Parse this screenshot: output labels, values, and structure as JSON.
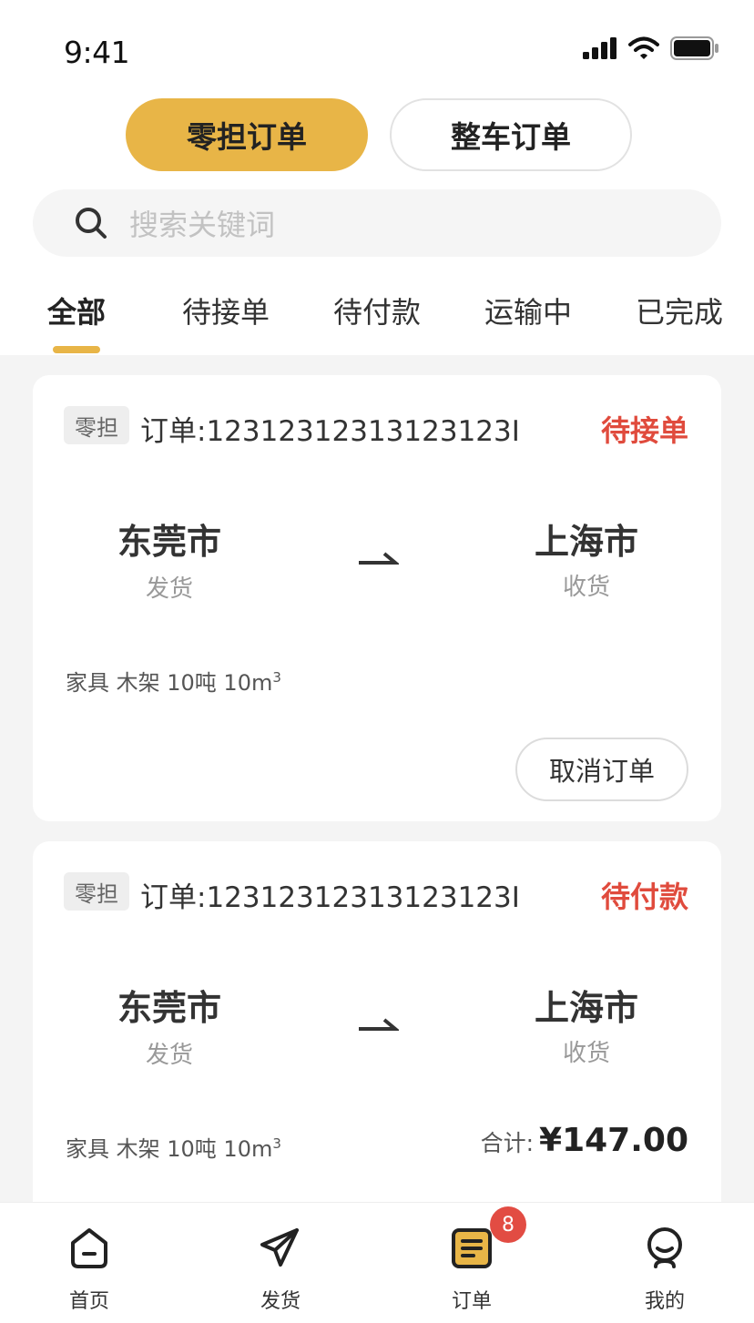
{
  "status_bar": {
    "time": "9:41"
  },
  "segments": [
    {
      "label": "零担订单",
      "active": true
    },
    {
      "label": "整车订单",
      "active": false
    }
  ],
  "search": {
    "placeholder": "搜索关键词"
  },
  "tabs": [
    {
      "label": "全部",
      "active": true
    },
    {
      "label": "待接单"
    },
    {
      "label": "待付款"
    },
    {
      "label": "运输中"
    },
    {
      "label": "已完成"
    }
  ],
  "orders": [
    {
      "tag": "零担",
      "order_no": "订单:12312312313123123I",
      "status": "待接单",
      "from_city": "东莞市",
      "from_label": "发货",
      "to_city": "上海市",
      "to_label": "收货",
      "goods": "家具 木架 10吨 10m",
      "goods_sup": "3",
      "action": "取消订单"
    },
    {
      "tag": "零担",
      "order_no": "订单:12312312313123123I",
      "status": "待付款",
      "from_city": "东莞市",
      "from_label": "发货",
      "to_city": "上海市",
      "to_label": "收货",
      "goods": "家具 木架 10吨 10m",
      "goods_sup": "3",
      "total_label": "合计:",
      "total_amount": "¥147.00"
    }
  ],
  "bottom_nav": [
    {
      "label": "首页",
      "icon": "home-icon"
    },
    {
      "label": "发货",
      "icon": "send-icon"
    },
    {
      "label": "订单",
      "icon": "order-icon",
      "badge": "8",
      "active": true
    },
    {
      "label": "我的",
      "icon": "profile-icon"
    }
  ],
  "colors": {
    "accent": "#e8b547",
    "status_red": "#e04b3d",
    "badge_red": "#e24c43"
  }
}
